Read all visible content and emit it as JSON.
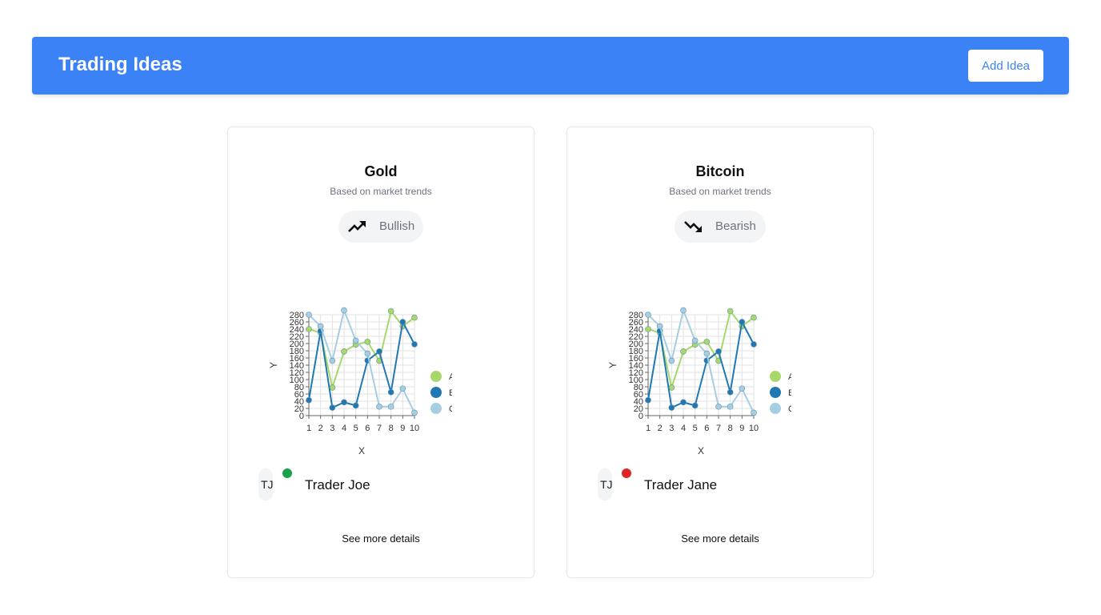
{
  "header": {
    "title": "Trading Ideas",
    "add_button_label": "Add Idea"
  },
  "cards": [
    {
      "title": "Gold",
      "subtitle": "Based on market trends",
      "trend": {
        "label": "Bullish",
        "icon": "trend-up-icon"
      },
      "trader": {
        "initials": "TJ",
        "name": "Trader Joe",
        "status_color": "#16a34a"
      },
      "details_label": "See more details"
    },
    {
      "title": "Bitcoin",
      "subtitle": "Based on market trends",
      "trend": {
        "label": "Bearish",
        "icon": "trend-down-icon"
      },
      "trader": {
        "initials": "TJ",
        "name": "Trader Jane",
        "status_color": "#dc2626"
      },
      "details_label": "See more details"
    }
  ],
  "colors": {
    "accent": "#3b82f6",
    "series_a": "#a6d96a",
    "series_b": "#1f78b4",
    "series_c": "#a6cee3"
  },
  "chart_data": [
    {
      "type": "line",
      "xlabel": "X",
      "ylabel": "Y",
      "xlim": [
        1,
        10
      ],
      "ylim": [
        0,
        280
      ],
      "x_ticks": [
        1,
        2,
        3,
        4,
        5,
        6,
        7,
        8,
        9,
        10
      ],
      "y_ticks": [
        0,
        20,
        40,
        60,
        80,
        100,
        120,
        140,
        160,
        180,
        200,
        220,
        240,
        260,
        280
      ],
      "grid": true,
      "legend": "right",
      "x": [
        1,
        2,
        3,
        4,
        5,
        6,
        7,
        8,
        9,
        10
      ],
      "series": [
        {
          "name": "A",
          "color": "#a6d96a",
          "values": [
            240,
            230,
            78,
            178,
            197,
            205,
            152,
            290,
            248,
            272
          ]
        },
        {
          "name": "B",
          "color": "#1f78b4",
          "values": [
            43,
            235,
            22,
            37,
            28,
            153,
            178,
            65,
            260,
            198
          ]
        },
        {
          "name": "C",
          "color": "#a6cee3",
          "values": [
            280,
            248,
            152,
            292,
            208,
            172,
            25,
            25,
            75,
            8
          ]
        }
      ]
    },
    {
      "type": "line",
      "xlabel": "X",
      "ylabel": "Y",
      "xlim": [
        1,
        10
      ],
      "ylim": [
        0,
        280
      ],
      "x_ticks": [
        1,
        2,
        3,
        4,
        5,
        6,
        7,
        8,
        9,
        10
      ],
      "y_ticks": [
        0,
        20,
        40,
        60,
        80,
        100,
        120,
        140,
        160,
        180,
        200,
        220,
        240,
        260,
        280
      ],
      "grid": true,
      "legend": "right",
      "x": [
        1,
        2,
        3,
        4,
        5,
        6,
        7,
        8,
        9,
        10
      ],
      "series": [
        {
          "name": "A",
          "color": "#a6d96a",
          "values": [
            240,
            230,
            78,
            178,
            197,
            205,
            152,
            290,
            248,
            272
          ]
        },
        {
          "name": "B",
          "color": "#1f78b4",
          "values": [
            43,
            235,
            22,
            37,
            28,
            153,
            178,
            65,
            260,
            198
          ]
        },
        {
          "name": "C",
          "color": "#a6cee3",
          "values": [
            280,
            248,
            152,
            292,
            208,
            172,
            25,
            25,
            75,
            8
          ]
        }
      ]
    }
  ]
}
